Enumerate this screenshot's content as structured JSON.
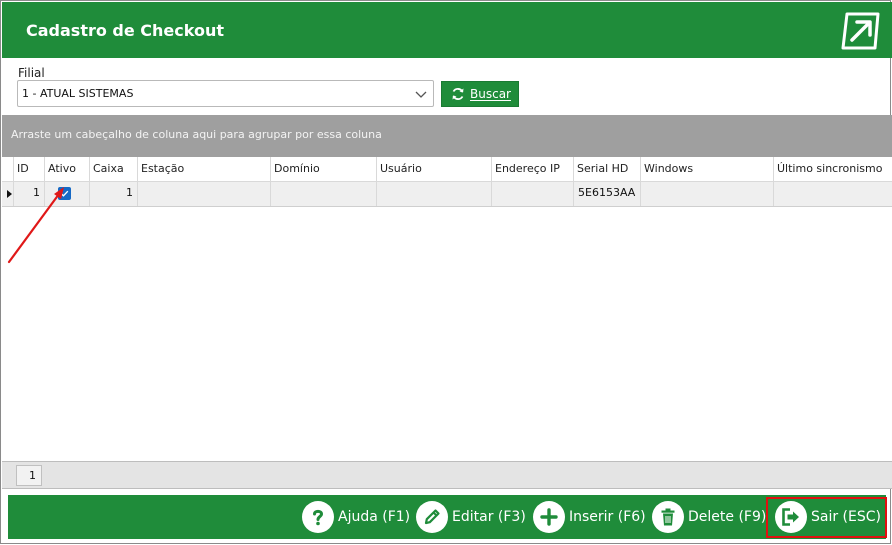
{
  "window": {
    "title": "Cadastro de Checkout",
    "logo_icon": "arrow-up-right-icon"
  },
  "filter": {
    "label": "Filial",
    "selected": "1 - ATUAL SISTEMAS",
    "search_button": "Buscar"
  },
  "grid": {
    "group_hint": "Arraste um cabeçalho de coluna aqui para agrupar por essa coluna",
    "columns": [
      "ID",
      "Ativo",
      "Caixa",
      "Estação",
      "Domínio",
      "Usuário",
      "Endereço IP",
      "Serial HD",
      "Windows",
      "Último sincronismo"
    ],
    "rows": [
      {
        "id": "1",
        "ativo": true,
        "caixa": "1",
        "estacao": "",
        "dominio": "",
        "usuario": "",
        "endereco_ip": "",
        "serial_hd": "5E6153AA",
        "windows": "",
        "ultimo_sincronismo": ""
      }
    ],
    "page": "1"
  },
  "toolbar": {
    "help": "Ajuda (F1)",
    "edit": "Editar (F3)",
    "insert": "Inserir (F6)",
    "delete": "Delete (F9)",
    "exit": "Sair (ESC)"
  },
  "colors": {
    "brand_green": "#1f8c3a",
    "group_bar": "#9f9f9f",
    "checkbox_blue": "#1669c5",
    "highlight_red": "#e01010"
  }
}
